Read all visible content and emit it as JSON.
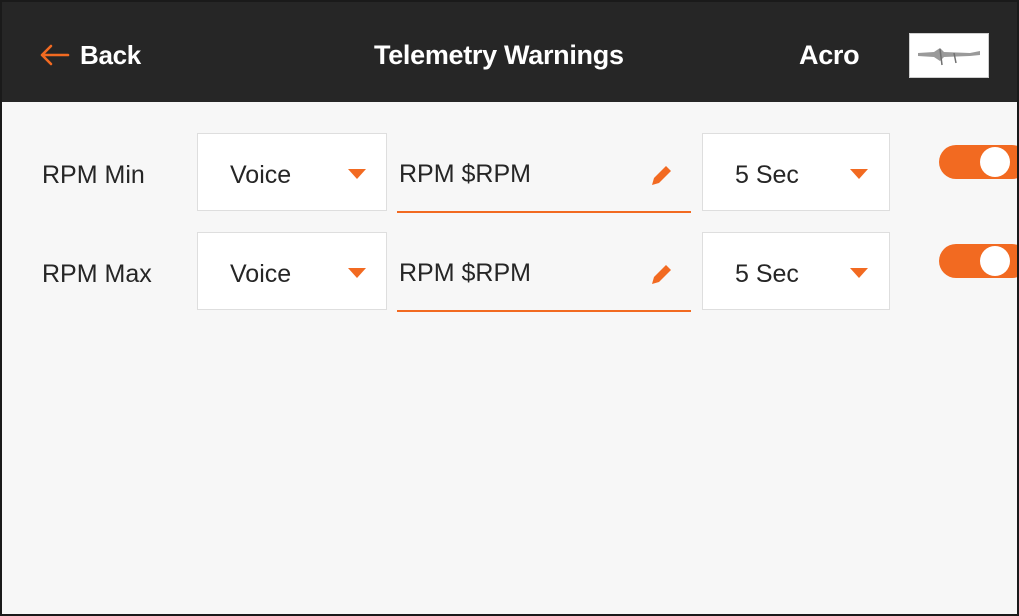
{
  "header": {
    "back_label": "Back",
    "title": "Telemetry Warnings",
    "model_name": "Acro"
  },
  "colors": {
    "accent": "#f26a21",
    "header_bg": "#262626",
    "page_bg": "#f7f7f7"
  },
  "icons": {
    "back": "arrow-left-icon",
    "dropdown": "caret-down-icon",
    "edit": "pencil-icon",
    "model": "airplane-thumbnail"
  },
  "warnings": [
    {
      "label": "RPM Min",
      "alert_type": "Voice",
      "message": "RPM $RPM",
      "repeat": "5 Sec",
      "enabled": true
    },
    {
      "label": "RPM Max",
      "alert_type": "Voice",
      "message": "RPM $RPM",
      "repeat": "5 Sec",
      "enabled": true
    }
  ]
}
